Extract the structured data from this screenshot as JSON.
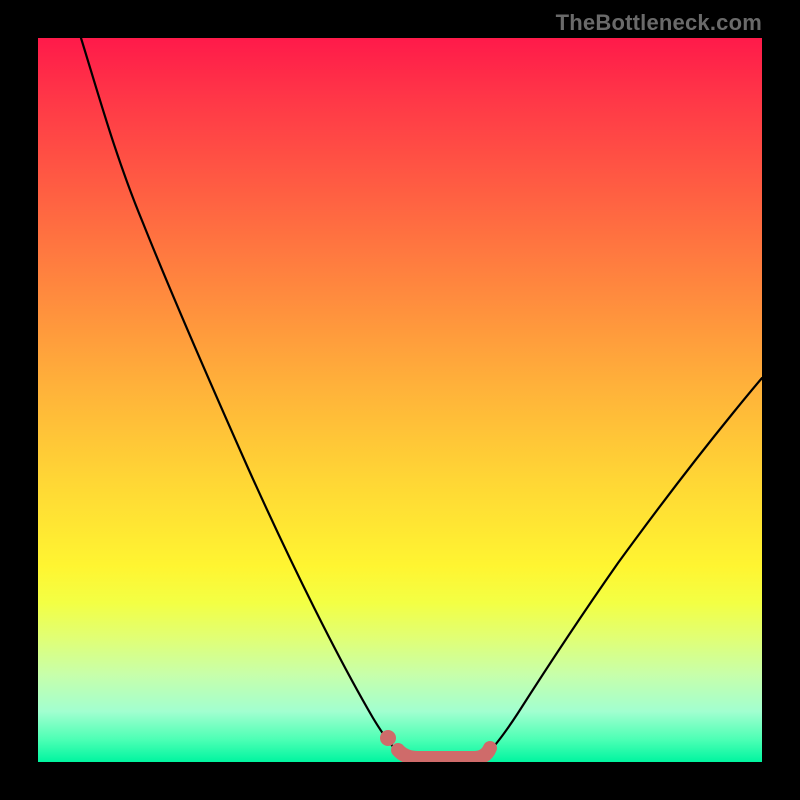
{
  "watermark": "TheBottleneck.com",
  "colors": {
    "frame_bg": "#000000",
    "gradient_top": "#ff1a4a",
    "gradient_bottom": "#00f5a0",
    "curve": "#000000",
    "marker": "#cf6b6a"
  },
  "chart_data": {
    "type": "line",
    "title": "",
    "xlabel": "",
    "ylabel": "",
    "xlim": [
      0,
      100
    ],
    "ylim": [
      0,
      100
    ],
    "series": [
      {
        "name": "left-curve",
        "x": [
          6,
          10,
          15,
          20,
          25,
          30,
          35,
          40,
          45,
          48,
          50
        ],
        "values": [
          100,
          91,
          80,
          69,
          57,
          46,
          34,
          23,
          11,
          4,
          1
        ]
      },
      {
        "name": "right-curve",
        "x": [
          62,
          65,
          70,
          75,
          80,
          85,
          90,
          95,
          100
        ],
        "values": [
          1,
          4,
          11,
          18,
          25,
          32,
          39,
          46,
          53
        ]
      },
      {
        "name": "flat-segment",
        "x": [
          50,
          53,
          56,
          59,
          62
        ],
        "values": [
          1,
          0,
          0,
          0,
          1
        ]
      }
    ],
    "annotations": [
      {
        "name": "marker-dot",
        "x": 48.5,
        "y": 3.5
      }
    ],
    "grid": false,
    "legend": false
  }
}
